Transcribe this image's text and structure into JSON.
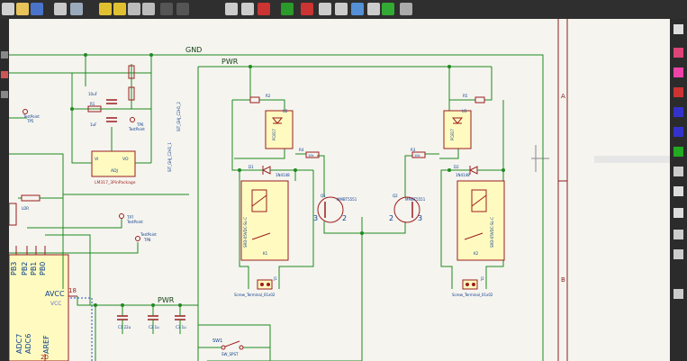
{
  "toolbar": {
    "icons": [
      "new-icon",
      "open-icon",
      "save-icon",
      "print-icon",
      "plot-icon",
      "undo-icon",
      "redo-icon",
      "find-icon",
      "zoom-icon",
      "annotate-icon",
      "netlist-icon",
      "bom-icon",
      "simulate-icon",
      "footprint-icon"
    ]
  },
  "colors": {
    "wire": "#1f8a1f",
    "part": "#9c1d1d",
    "fill": "#fffbc0",
    "text": "#0b3d8c",
    "label": "#134013",
    "frame": "#8a1e1e"
  },
  "nets": {
    "gnd": "GND",
    "pwr": "PWR",
    "pwr2": "PWR"
  },
  "frame": {
    "row_a": "A",
    "row_b": "B"
  },
  "regulator": {
    "name": "LM317_3PinPackage",
    "vi": "VI",
    "vo": "VO",
    "adj": "ADJ",
    "r_label": "R1"
  },
  "labels": {
    "tp_left": "TestPoint",
    "tp_left_ref": "TP5",
    "tp_top": "TP6",
    "tp_top_sub": "TestPoint",
    "tp_mid": "TP7",
    "tp_mid_sub": "TestPoint",
    "tp_low": "TestPoint",
    "tp_low_ref": "TP8",
    "ldr": "LDR",
    "conn_left": "SIT_GHJ_C2H1_1",
    "conn_left2": "SIT_GHJ_C2H1_2",
    "caps": [
      "C1 22u",
      "C2 1u",
      "C3 1u"
    ],
    "sw": "SW1",
    "sw_sub": "SW_SPST",
    "c_top": "10uF",
    "c_top2": "1uF",
    "mcu_pins": [
      "PB3",
      "PB2",
      "PB1",
      "PB0"
    ],
    "mcu_avcc": "AVCC",
    "mcu_vcc": "VCC",
    "mcu_adc7": "ADC7",
    "mcu_adc6": "ADC6",
    "mcu_aref": "AREF",
    "mcu_pin18": "18",
    "mcu_pin20": "20"
  },
  "channel_left": {
    "opto_ref": "U2",
    "opto_part": "PC817",
    "r_top": "R2",
    "diode": "D1",
    "diode_part": "1N4148",
    "relay": "SRD-05VDC-SL-C",
    "relay_ref": "K1",
    "r_base": "R4",
    "r_val": "10k",
    "transistor": "Q1",
    "transistor_part": "MMBT5551",
    "pin_b": "3",
    "pin_e": "2",
    "terminal": "Screw_Terminal_01x02",
    "terminal_ref": "J1"
  },
  "channel_right": {
    "opto_ref": "U3",
    "opto_part": "PC817",
    "r_top": "R5",
    "diode": "D2",
    "diode_part": "1N4148",
    "relay": "SRD-05VDC-SL-C",
    "relay_ref": "K2",
    "r_base": "R3",
    "r_val": "10k",
    "transistor": "Q2",
    "transistor_part": "MMBT5551",
    "pin_b": "2",
    "pin_e": "3",
    "terminal": "Screw_Terminal_01x02",
    "terminal_ref": "J2"
  }
}
